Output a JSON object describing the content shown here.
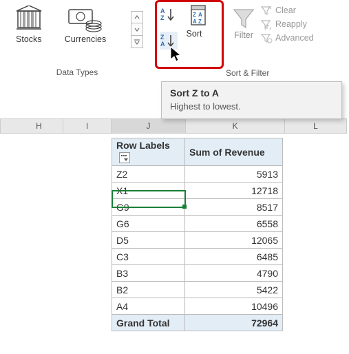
{
  "ribbon": {
    "datatypes": {
      "label": "Data Types",
      "stocks": "Stocks",
      "currencies": "Currencies"
    },
    "sort": {
      "sort_label": "Sort",
      "group_label": "Sort & Filter",
      "filter_label": "Filter",
      "clear_label": "Clear",
      "reapply_label": "Reapply",
      "advanced_label": "Advanced"
    }
  },
  "tooltip": {
    "title": "Sort Z to A",
    "body": "Highest to lowest."
  },
  "columns": [
    "H",
    "I",
    "J",
    "K",
    "L"
  ],
  "pivot": {
    "row_header": "Row Labels",
    "val_header": "Sum of Revenue",
    "rows": [
      {
        "label": "Z2",
        "value": "5913"
      },
      {
        "label": "X1",
        "value": "12718"
      },
      {
        "label": "G9",
        "value": "8517"
      },
      {
        "label": "G6",
        "value": "6558"
      },
      {
        "label": "D5",
        "value": "12065"
      },
      {
        "label": "C3",
        "value": "6485"
      },
      {
        "label": "B3",
        "value": "4790"
      },
      {
        "label": "B2",
        "value": "5422"
      },
      {
        "label": "A4",
        "value": "10496"
      }
    ],
    "total_label": "Grand Total",
    "total_value": "72964"
  }
}
